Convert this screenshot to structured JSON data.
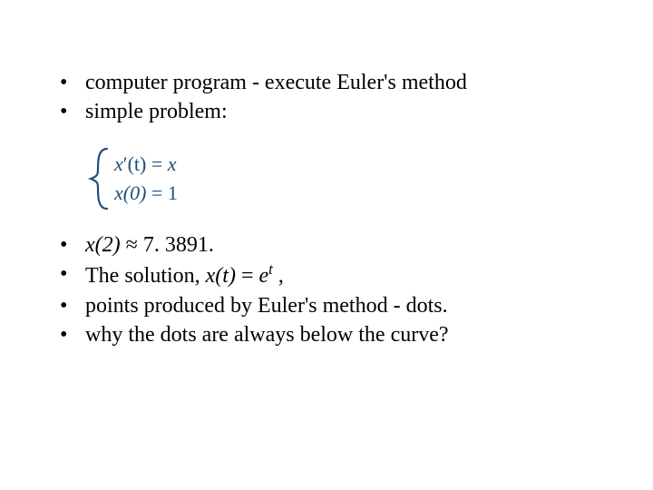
{
  "top_bullets": [
    "computer program - execute Euler's method",
    "simple problem:"
  ],
  "equation": {
    "line1_lhs_var": "x",
    "line1_lhs_prime": "′",
    "line1_lhs_arg": "(t)",
    "line1_eq": " = ",
    "line1_rhs": "x",
    "line2_lhs": "x(0)",
    "line2_eq": " = ",
    "line2_rhs": "1",
    "color": "#1f4e79"
  },
  "bottom_bullets": [
    {
      "prefix_italic": "x(2)",
      "middle": " ≈ 7. 3891.",
      "suffix_plain": ""
    },
    {
      "prefix_plain": "The solution, ",
      "italic1": "x(t)",
      "mid": " = ",
      "italic2": "e",
      "sup": "t",
      "suffix_plain": " ,"
    },
    {
      "prefix_plain": "points produced by Euler's method - dots.",
      "italic1": "",
      "mid": "",
      "italic2": "",
      "sup": "",
      "suffix_plain": ""
    },
    {
      "prefix_plain": "why the dots are always below the curve?",
      "italic1": "",
      "mid": "",
      "italic2": "",
      "sup": "",
      "suffix_plain": ""
    }
  ]
}
